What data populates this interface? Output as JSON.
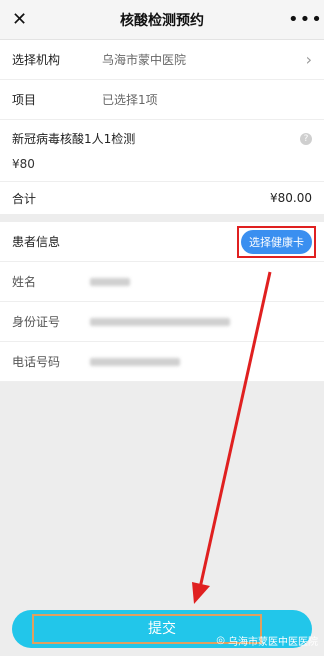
{
  "topbar": {
    "close_icon": "close-icon",
    "title": "核酸检测预约",
    "more_icon": "more-dots-icon"
  },
  "institution": {
    "label": "选择机构",
    "value": "乌海市蒙中医院"
  },
  "project": {
    "label": "项目",
    "value": "已选择1项"
  },
  "test_item": {
    "name": "新冠病毒核酸1人1检测",
    "price": "¥80"
  },
  "total": {
    "label": "合计",
    "value": "¥80.00"
  },
  "patient": {
    "title": "患者信息",
    "card_button": "选择健康卡",
    "name_label": "姓名",
    "id_label": "身份证号",
    "phone_label": "电话号码"
  },
  "submit": {
    "label": "提交"
  },
  "watermark": {
    "text": "乌海市蒙医中医医院"
  },
  "colors": {
    "primary": "#3a8ff0",
    "submit": "#22c6ea",
    "highlight": "#e02020"
  }
}
